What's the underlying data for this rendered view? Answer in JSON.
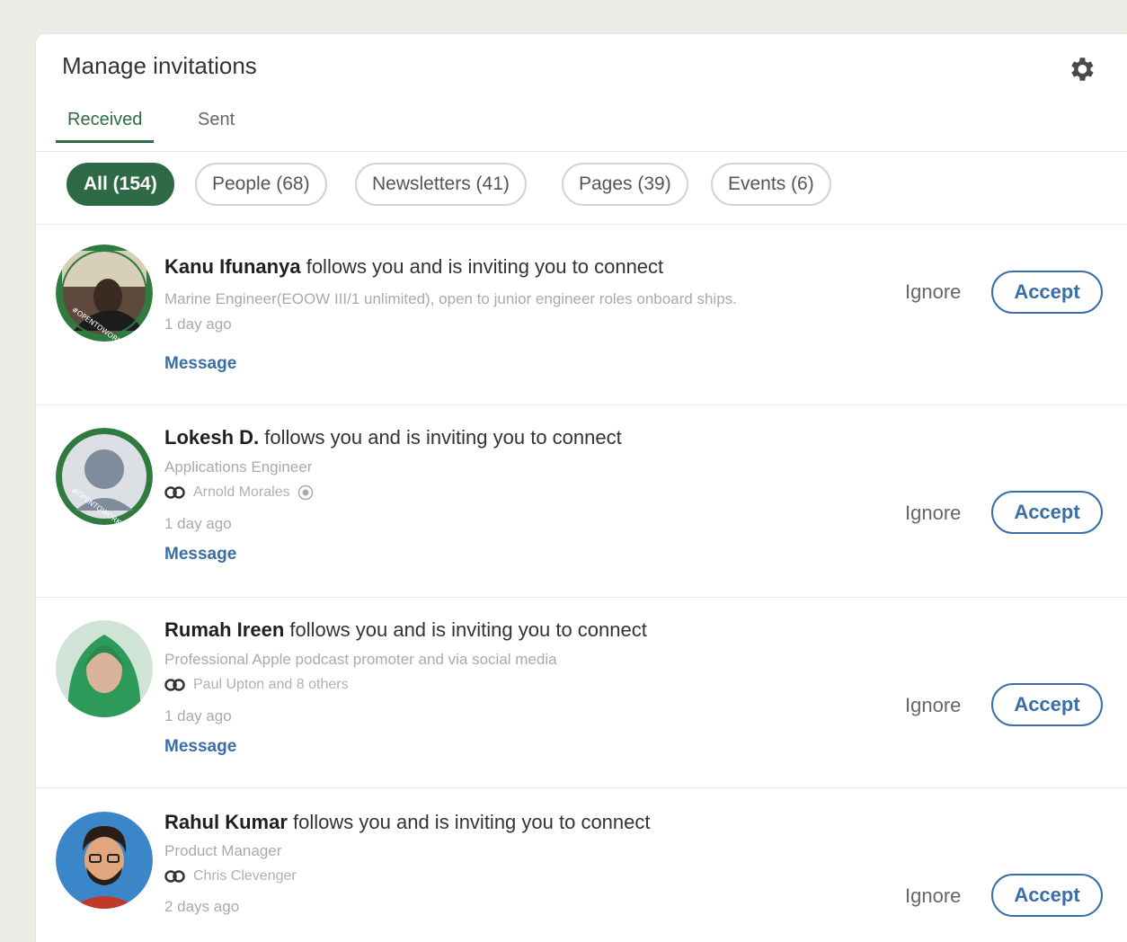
{
  "header": {
    "title": "Manage invitations",
    "settings_icon": "gear-icon"
  },
  "tabs": [
    {
      "label": "Received",
      "active": true
    },
    {
      "label": "Sent",
      "active": false
    }
  ],
  "filters": [
    {
      "label": "All (154)",
      "active": true
    },
    {
      "label": "People (68)",
      "active": false
    },
    {
      "label": "Newsletters (41)",
      "active": false
    },
    {
      "label": "Pages (39)",
      "active": false
    },
    {
      "label": "Events (6)",
      "active": false
    }
  ],
  "action_labels": {
    "ignore": "Ignore",
    "accept": "Accept",
    "message": "Message"
  },
  "invitations": [
    {
      "name": "Kanu Ifunanya",
      "text": "follows you and is inviting you to connect",
      "headline": "Marine Engineer(EOOW III/1 unlimited), open to junior engineer roles onboard ships.",
      "mutual": "",
      "time": "1 day ago"
    },
    {
      "name": "Lokesh D.",
      "text": "follows you and is inviting you to connect",
      "headline": "Applications Engineer",
      "mutual": "Arnold Morales",
      "time": "1 day ago"
    },
    {
      "name": "Rumah Ireen",
      "text": "follows you and is inviting you to connect",
      "headline": "Professional Apple podcast promoter and via social media",
      "mutual": "Paul Upton and 8 others",
      "time": "1 day ago"
    },
    {
      "name": "Rahul Kumar",
      "text": "follows you and is inviting you to connect",
      "headline": "Product Manager",
      "mutual": "Chris Clevenger",
      "time": "2 days ago"
    }
  ],
  "colors": {
    "brand_green": "#2d6a45",
    "link_blue": "#3a6ea5",
    "open_to_work_green": "#2f7a3f"
  }
}
